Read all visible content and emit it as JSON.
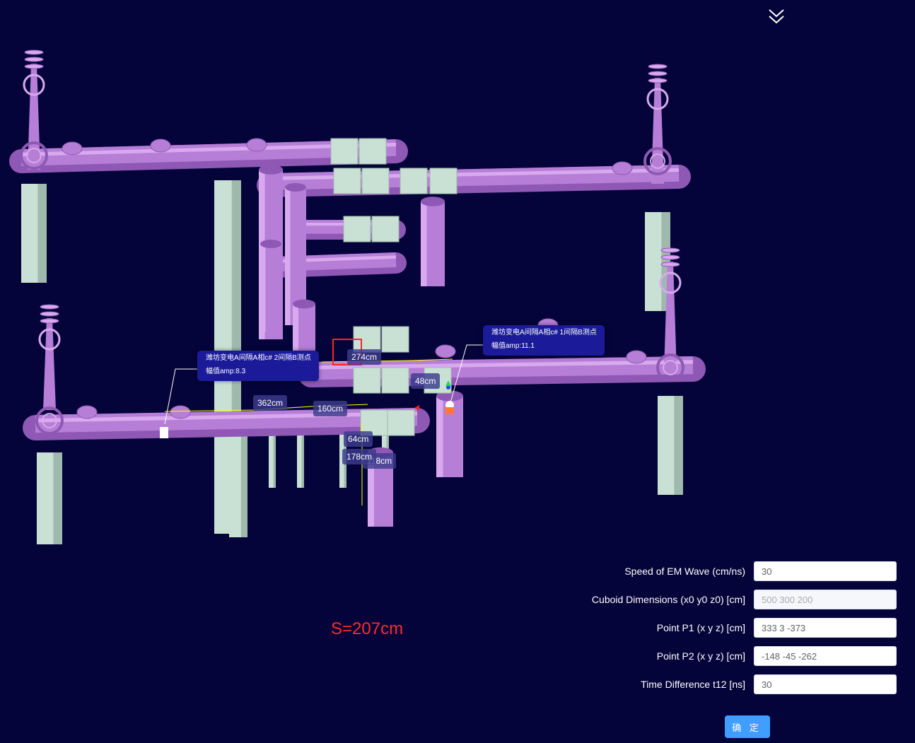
{
  "scene": {
    "label_p2": {
      "name": "潍坊变电A间隔A相c# 2间隔B测点",
      "amp": "幅值amp:8.3"
    },
    "label_p1": {
      "name": "潍坊变电A间隔A相c# 1间隔B测点",
      "amp": "幅值amp:11.1"
    },
    "measurements": [
      "274cm",
      "48cm",
      "362cm",
      "160cm",
      "64cm",
      "178cm",
      "118cm"
    ],
    "colors": {
      "pipe": "#b67ed6",
      "support": "#c9e1d4",
      "background": "#04043a",
      "tooltip": "#1b1b9a"
    }
  },
  "result": {
    "text": "S=207cm",
    "color": "#ff2a2a"
  },
  "form": {
    "speed": {
      "label": "Speed of EM Wave (cm/ns)",
      "value": "30"
    },
    "cuboid": {
      "label": "Cuboid Dimensions (x0 y0 z0) [cm]",
      "value": "500 300 200"
    },
    "p1": {
      "label": "Point P1 (x y z) [cm]",
      "value": "333 3 -373"
    },
    "p2": {
      "label": "Point P2 (x y z) [cm]",
      "value": "-148 -45 -262"
    },
    "t12": {
      "label": "Time Difference t12 [ns]",
      "value": "30"
    },
    "confirm_label": "确 定"
  },
  "icons": {
    "toggle": "double-chevron-down-icon"
  }
}
